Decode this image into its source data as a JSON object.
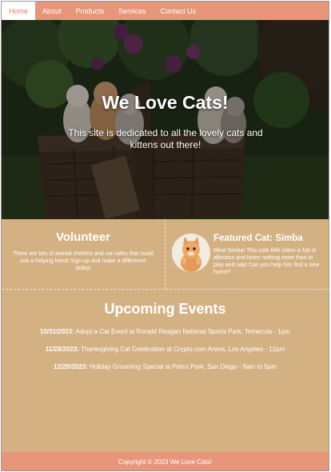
{
  "nav": {
    "items": [
      {
        "label": "Home"
      },
      {
        "label": "About"
      },
      {
        "label": "Products"
      },
      {
        "label": "Services"
      },
      {
        "label": "Contact Us"
      }
    ]
  },
  "hero": {
    "title": "We Love Cats!",
    "subtitle": "This site is dedicated to all the lovely cats and kittens out there!"
  },
  "volunteer": {
    "heading": "Volunteer",
    "text": "There are lots of animal shelters and cat cafes that could use a helping hand! Sign up and make a difference today!"
  },
  "featured": {
    "heading": "Featured Cat: Simba",
    "text": "Meet Simba! This cute little kitten is full of affection and loves nothing more than to play and nap! Can you help him find a new home?"
  },
  "events": {
    "heading": "Upcoming Events",
    "items": [
      {
        "date": "10/31/2023:",
        "text": " Adopt a Cat Event at Ronald Reagan National Sports Park, Temecula - 1pm"
      },
      {
        "date": "11/28/2023:",
        "text": " Thanksgiving Cat Celebration at Crypto.com Arena, Los Angeles - 12pm"
      },
      {
        "date": "12/20/2023:",
        "text": " Holiday Grooming Special at Petco Park, San Diego - 9am to 5pm"
      }
    ]
  },
  "footer": {
    "text": "Copyright © 2023 We Love Cats!"
  },
  "colors": {
    "nav_bg": "#e8967a",
    "body_bg": "#d4b183",
    "active_tab_text": "#e07b62"
  }
}
